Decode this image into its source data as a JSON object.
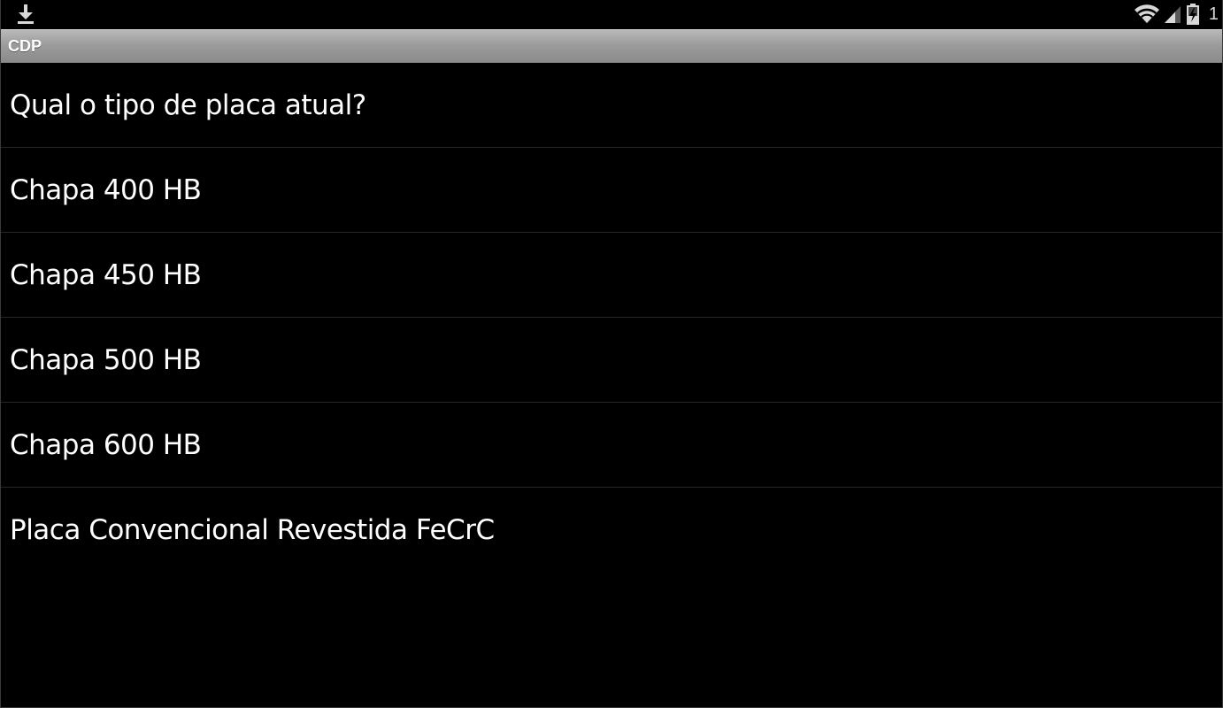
{
  "status_bar": {
    "left_icon": "download-icon",
    "right_icons": [
      "wifi-icon",
      "signal-icon",
      "battery-charging-icon"
    ],
    "time_fragment": "1"
  },
  "title_bar": {
    "title": "CDP"
  },
  "list": {
    "question": "Qual o tipo de placa atual?",
    "options": [
      "Chapa 400 HB",
      "Chapa 450 HB",
      "Chapa 500 HB",
      "Chapa 600 HB",
      "Placa Convencional Revestida FeCrC"
    ]
  },
  "colors": {
    "background": "#000000",
    "title_bar": "#9c9c9c",
    "text": "#ffffff",
    "divider": "#262626"
  }
}
